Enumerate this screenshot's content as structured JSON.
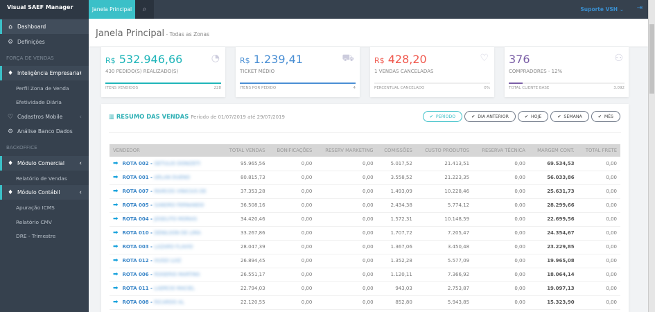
{
  "app": {
    "title": "Visual SAEF Manager"
  },
  "topbar": {
    "tab": "Janela Principal",
    "user": "Suporte VSH"
  },
  "sidebar": {
    "items": [
      {
        "label": "Dashboard",
        "icon": "home-icon"
      },
      {
        "label": "Definições",
        "icon": "gear-icon"
      },
      {
        "label": "Inteligência Empresarial",
        "icon": "diamond-icon"
      },
      {
        "label": "Cadastros Mobile",
        "icon": "heart-icon"
      },
      {
        "label": "Análise Banco Dados",
        "icon": "gear-icon"
      },
      {
        "label": "Módulo Comercial",
        "icon": "diamond-icon"
      },
      {
        "label": "Módulo Contábil",
        "icon": "diamond-icon"
      }
    ],
    "sections": [
      "FORÇA DE VENDAS",
      "BACKOFFICE"
    ],
    "subitems": [
      "Perfil Zona de Venda",
      "Efetividade Diária",
      "Relatório de Vendas",
      "Apuração ICMS",
      "Relatório CMV",
      "DRE - Trimestre"
    ]
  },
  "header": {
    "title": "Janela Principal",
    "subtitle": "Todas as Zonas"
  },
  "cards": [
    {
      "currency": "R$",
      "value": "532.946,66",
      "label": "430 PEDIDO(S) REALIZADO(S)",
      "foot": "ITENS VENDIDOS",
      "foot_value": "228",
      "color": "#1fb5b9",
      "progress": 1.0,
      "icon": "pie-chart-icon"
    },
    {
      "currency": "R$",
      "value": "1.239,41",
      "label": "TICKET MÉDIO",
      "foot": "ITENS POR PEDIDO",
      "foot_value": "4",
      "color": "#4a8fd4",
      "progress": 1.0,
      "icon": "cart-icon"
    },
    {
      "currency": "R$",
      "value": "428,20",
      "label": "1 VENDAS CANCELADAS",
      "foot": "PERCENTUAL CANCELADO",
      "foot_value": "0%",
      "color": "#f0594e",
      "progress": 0.0,
      "icon": "thumbs-down-icon"
    },
    {
      "currency": "",
      "value": "376",
      "label": "COMPRADORES - 12%",
      "foot": "TOTAL CLIENTE BASE",
      "foot_value": "3.092",
      "color": "#7a5ea6",
      "progress": 0.12,
      "icon": "user-icon"
    }
  ],
  "panel": {
    "title": "RESUMO DAS VENDAS",
    "period": "Período de 01/07/2019 até 29/07/2019",
    "buttons": [
      "PERÍODO",
      "DIA ANTERIOR",
      "HOJE",
      "SEMANA",
      "MÊS"
    ],
    "columns": [
      "VENDEDOR",
      "TOTAL VENDAS",
      "BONIFICAÇÕES",
      "RESERV MARKETING",
      "COMISSÕES",
      "CUSTO PRODUTOS",
      "RESERVA TÉCNICA",
      "MARGEM CONT.",
      "TOTAL FRETE"
    ],
    "rows": [
      [
        "ROTA 002 - ",
        "GETULIO DONIZETI",
        "95.965,56",
        "0,00",
        "0,00",
        "5.017,52",
        "21.413,51",
        "0,00",
        "69.534,53",
        "0,00"
      ],
      [
        "ROTA 001 - ",
        "ARLAN DUENO",
        "80.815,73",
        "0,00",
        "0,00",
        "3.558,52",
        "21.223,35",
        "0,00",
        "56.033,86",
        "0,00"
      ],
      [
        "ROTA 007 - ",
        "MARCOS VINICIUS DE",
        "37.353,28",
        "0,00",
        "0,00",
        "1.493,09",
        "10.228,46",
        "0,00",
        "25.631,73",
        "0,00"
      ],
      [
        "ROTA 005 - ",
        "SANDRO FERNANDO",
        "36.508,16",
        "0,00",
        "0,00",
        "2.434,38",
        "5.774,12",
        "0,00",
        "28.299,66",
        "0,00"
      ],
      [
        "ROTA 004 - ",
        "JOSELITO MORAIS",
        "34.420,46",
        "0,00",
        "0,00",
        "1.572,31",
        "10.148,59",
        "0,00",
        "22.699,56",
        "0,00"
      ],
      [
        "ROTA 010 - ",
        "DENILSON DE LIMA",
        "33.267,86",
        "0,00",
        "0,00",
        "1.707,72",
        "7.205,47",
        "0,00",
        "24.354,67",
        "0,00"
      ],
      [
        "ROTA 003 - ",
        "LAZARO FLAVIO",
        "28.047,39",
        "0,00",
        "0,00",
        "1.367,06",
        "3.450,48",
        "0,00",
        "23.229,85",
        "0,00"
      ],
      [
        "ROTA 012 - ",
        "HUGO LUIZ",
        "26.894,45",
        "0,00",
        "0,00",
        "1.352,28",
        "5.577,09",
        "0,00",
        "19.965,08",
        "0,00"
      ],
      [
        "ROTA 006 - ",
        "ROGERIO MARTINS",
        "26.551,17",
        "0,00",
        "0,00",
        "1.120,11",
        "7.366,92",
        "0,00",
        "18.064,14",
        "0,00"
      ],
      [
        "ROTA 011 - ",
        "LAERCIO MACIEL",
        "22.794,03",
        "0,00",
        "0,00",
        "943,03",
        "2.753,87",
        "0,00",
        "19.097,13",
        "0,00"
      ],
      [
        "ROTA 008 - ",
        "RICARDO AL",
        "22.120,55",
        "0,00",
        "0,00",
        "852,80",
        "5.943,85",
        "0,00",
        "15.323,90",
        "0,00"
      ]
    ]
  }
}
